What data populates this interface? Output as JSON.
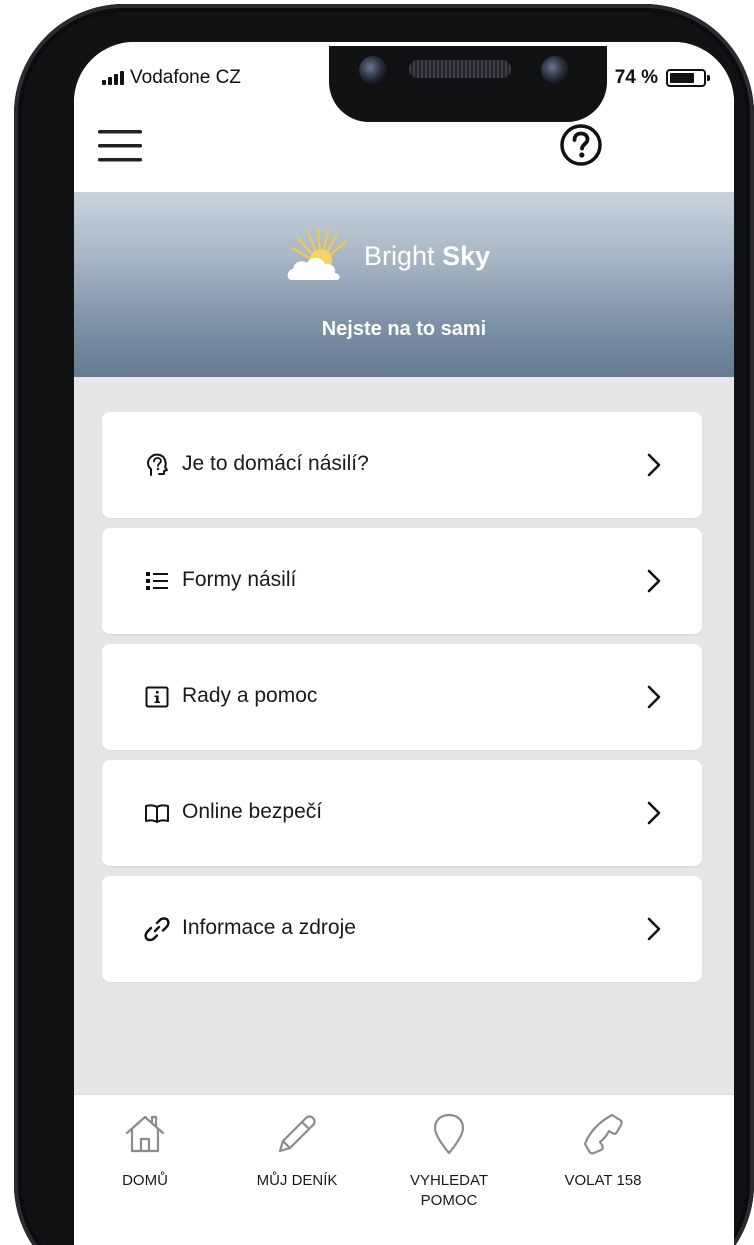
{
  "status_bar": {
    "carrier": "Vodafone CZ",
    "battery": "74 %",
    "battery_level": 0.74
  },
  "app_bar": {
    "menu_icon": "hamburger-menu-icon",
    "help_icon": "help-circle-icon"
  },
  "hero": {
    "brand_regular": "Bright",
    "brand_bold": "Sky",
    "tagline": "Nejste na to sami"
  },
  "menu": {
    "items": [
      {
        "label": "Je to domácí násilí?",
        "icon": "question-head-icon"
      },
      {
        "label": "Formy násilí",
        "icon": "list-icon"
      },
      {
        "label": "Rady a pomoc",
        "icon": "info-icon"
      },
      {
        "label": "Online bezpečí",
        "icon": "book-icon"
      },
      {
        "label": "Informace a zdroje",
        "icon": "link-icon"
      }
    ]
  },
  "bottom_nav": {
    "items": [
      {
        "label": "DOMŮ",
        "icon": "home-icon"
      },
      {
        "label": "MŮJ DENÍK",
        "icon": "pencil-icon"
      },
      {
        "label": "VYHLEDAT POMOC",
        "icon": "location-pin-icon"
      },
      {
        "label": "VOLAT 158",
        "icon": "phone-icon"
      }
    ]
  },
  "colors": {
    "hero_top": "#c9d3dc",
    "hero_bottom": "#647b92",
    "background": "#e6e6e8",
    "card": "#ffffff",
    "text": "#1a1a1a"
  }
}
